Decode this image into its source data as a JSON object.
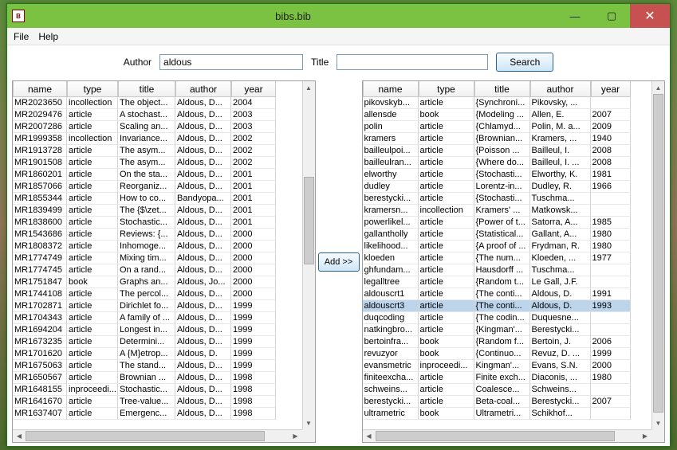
{
  "window": {
    "title": "bibs.bib",
    "icon_text": "B"
  },
  "menu": {
    "file": "File",
    "help": "Help"
  },
  "search": {
    "author_label": "Author",
    "author_value": "aldous",
    "title_label": "Title",
    "title_value": "",
    "button": "Search"
  },
  "add_button": "Add >>",
  "columns": {
    "name": "name",
    "type": "type",
    "title": "title",
    "author": "author",
    "year": "year"
  },
  "left_rows": [
    {
      "name": "MR2023650",
      "type": "incollection",
      "title": "The object...",
      "author": "Aldous, D...",
      "year": "2004"
    },
    {
      "name": "MR2029476",
      "type": "article",
      "title": "A stochast...",
      "author": "Aldous, D...",
      "year": "2003"
    },
    {
      "name": "MR2007286",
      "type": "article",
      "title": "Scaling an...",
      "author": "Aldous, D...",
      "year": "2003"
    },
    {
      "name": "MR1999358",
      "type": "incollection",
      "title": "Invariance...",
      "author": "Aldous, D...",
      "year": "2002"
    },
    {
      "name": "MR1913728",
      "type": "article",
      "title": "The asym...",
      "author": "Aldous, D...",
      "year": "2002"
    },
    {
      "name": "MR1901508",
      "type": "article",
      "title": "The asym...",
      "author": "Aldous, D...",
      "year": "2002"
    },
    {
      "name": "MR1860201",
      "type": "article",
      "title": "On the sta...",
      "author": "Aldous, D...",
      "year": "2001"
    },
    {
      "name": "MR1857066",
      "type": "article",
      "title": "Reorganiz...",
      "author": "Aldous, D...",
      "year": "2001"
    },
    {
      "name": "MR1855344",
      "type": "article",
      "title": "How to co...",
      "author": "Bandyopa...",
      "year": "2001"
    },
    {
      "name": "MR1839499",
      "type": "article",
      "title": "The {$\\zet...",
      "author": "Aldous, D...",
      "year": "2001"
    },
    {
      "name": "MR1838600",
      "type": "article",
      "title": "Stochastic...",
      "author": "Aldous, D...",
      "year": "2001"
    },
    {
      "name": "MR1543686",
      "type": "article",
      "title": "Reviews: {...",
      "author": "Aldous, D...",
      "year": "2000"
    },
    {
      "name": "MR1808372",
      "type": "article",
      "title": "Inhomoge...",
      "author": "Aldous, D...",
      "year": "2000"
    },
    {
      "name": "MR1774749",
      "type": "article",
      "title": "Mixing tim...",
      "author": "Aldous, D...",
      "year": "2000"
    },
    {
      "name": "MR1774745",
      "type": "article",
      "title": "On a rand...",
      "author": "Aldous, D...",
      "year": "2000"
    },
    {
      "name": "MR1751847",
      "type": "book",
      "title": "Graphs an...",
      "author": "Aldous, Jo...",
      "year": "2000"
    },
    {
      "name": "MR1744108",
      "type": "article",
      "title": "The percol...",
      "author": "Aldous, D...",
      "year": "2000"
    },
    {
      "name": "MR1702871",
      "type": "article",
      "title": "Dirichlet fo...",
      "author": "Aldous, D...",
      "year": "1999"
    },
    {
      "name": "MR1704343",
      "type": "article",
      "title": "A family of ...",
      "author": "Aldous, D...",
      "year": "1999"
    },
    {
      "name": "MR1694204",
      "type": "article",
      "title": "Longest in...",
      "author": "Aldous, D...",
      "year": "1999"
    },
    {
      "name": "MR1673235",
      "type": "article",
      "title": "Determini...",
      "author": "Aldous, D...",
      "year": "1999"
    },
    {
      "name": "MR1701620",
      "type": "article",
      "title": "A {M}etrop...",
      "author": "Aldous, D.",
      "year": "1999"
    },
    {
      "name": "MR1675063",
      "type": "article",
      "title": "The stand...",
      "author": "Aldous, D...",
      "year": "1999"
    },
    {
      "name": "MR1650567",
      "type": "article",
      "title": "Brownian ...",
      "author": "Aldous, D...",
      "year": "1998"
    },
    {
      "name": "MR1648155",
      "type": "inproceedi...",
      "title": "Stochastic...",
      "author": "Aldous, D...",
      "year": "1998"
    },
    {
      "name": "MR1641670",
      "type": "article",
      "title": "Tree-value...",
      "author": "Aldous, D...",
      "year": "1998"
    },
    {
      "name": "MR1637407",
      "type": "article",
      "title": "Emergenc...",
      "author": "Aldous, D...",
      "year": "1998"
    }
  ],
  "right_rows": [
    {
      "name": "pikovskyb...",
      "type": "article",
      "title": "{Synchroni...",
      "author": "Pikovsky, ...",
      "year": ""
    },
    {
      "name": "allensde",
      "type": "book",
      "title": "{Modeling ...",
      "author": "Allen, E.",
      "year": "2007"
    },
    {
      "name": "polin",
      "type": "article",
      "title": "{Chlamyd...",
      "author": "Polin, M. a...",
      "year": "2009"
    },
    {
      "name": "kramers",
      "type": "article",
      "title": "{Brownian...",
      "author": "Kramers, ...",
      "year": "1940"
    },
    {
      "name": "bailleulpoi...",
      "type": "article",
      "title": "{Poisson ...",
      "author": "Bailleul, I.",
      "year": "2008"
    },
    {
      "name": "bailleulran...",
      "type": "article",
      "title": "{Where do...",
      "author": "Bailleul, I. ...",
      "year": "2008"
    },
    {
      "name": "elworthy",
      "type": "article",
      "title": "{Stochasti...",
      "author": "Elworthy, K.",
      "year": "1981"
    },
    {
      "name": "dudley",
      "type": "article",
      "title": "Lorentz-in...",
      "author": "Dudley, R.",
      "year": "1966"
    },
    {
      "name": "berestycki...",
      "type": "article",
      "title": "{Stochasti...",
      "author": "Tuschma...",
      "year": ""
    },
    {
      "name": "kramersn...",
      "type": "incollection",
      "title": "Kramers' ...",
      "author": "Matkowsk...",
      "year": ""
    },
    {
      "name": "powerlikel...",
      "type": "article",
      "title": "{Power of t...",
      "author": "Satorra, A...",
      "year": "1985"
    },
    {
      "name": "gallantholly",
      "type": "article",
      "title": "{Statistical...",
      "author": "Gallant, A...",
      "year": "1980"
    },
    {
      "name": "likelihood...",
      "type": "article",
      "title": "{A proof of ...",
      "author": "Frydman, R.",
      "year": "1980"
    },
    {
      "name": "kloeden",
      "type": "article",
      "title": "{The num...",
      "author": "Kloeden, ...",
      "year": "1977"
    },
    {
      "name": "ghfundam...",
      "type": "article",
      "title": "Hausdorff ...",
      "author": "Tuschma...",
      "year": ""
    },
    {
      "name": "legalltree",
      "type": "article",
      "title": "{Random t...",
      "author": "Le Gall, J.F.",
      "year": ""
    },
    {
      "name": "aldouscrt1",
      "type": "article",
      "title": "{The conti...",
      "author": "Aldous, D.",
      "year": "1991"
    },
    {
      "name": "aldouscrt3",
      "type": "article",
      "title": "{The conti...",
      "author": "Aldous, D.",
      "year": "1993",
      "sel": true
    },
    {
      "name": "duqcoding",
      "type": "article",
      "title": "{The codin...",
      "author": "Duquesne...",
      "year": ""
    },
    {
      "name": "natkingbro...",
      "type": "article",
      "title": "{Kingman'...",
      "author": "Berestycki...",
      "year": ""
    },
    {
      "name": "bertoinfra...",
      "type": "book",
      "title": "{Random f...",
      "author": "Bertoin, J.",
      "year": "2006"
    },
    {
      "name": "revuzyor",
      "type": "book",
      "title": "{Continuo...",
      "author": "Revuz, D. ...",
      "year": "1999"
    },
    {
      "name": "evansmetric",
      "type": "inproceedi...",
      "title": "Kingman'...",
      "author": "Evans, S.N.",
      "year": "2000"
    },
    {
      "name": "finiteexcha...",
      "type": "article",
      "title": "Finite exch...",
      "author": "Diaconis, ...",
      "year": "1980"
    },
    {
      "name": "schweins...",
      "type": "article",
      "title": "Coalesce...",
      "author": "Schweins...",
      "year": ""
    },
    {
      "name": "berestycki...",
      "type": "article",
      "title": "Beta-coal...",
      "author": "Berestycki...",
      "year": "2007"
    },
    {
      "name": "ultrametric",
      "type": "book",
      "title": "Ultrametri...",
      "author": "Schikhof...",
      "year": ""
    }
  ]
}
